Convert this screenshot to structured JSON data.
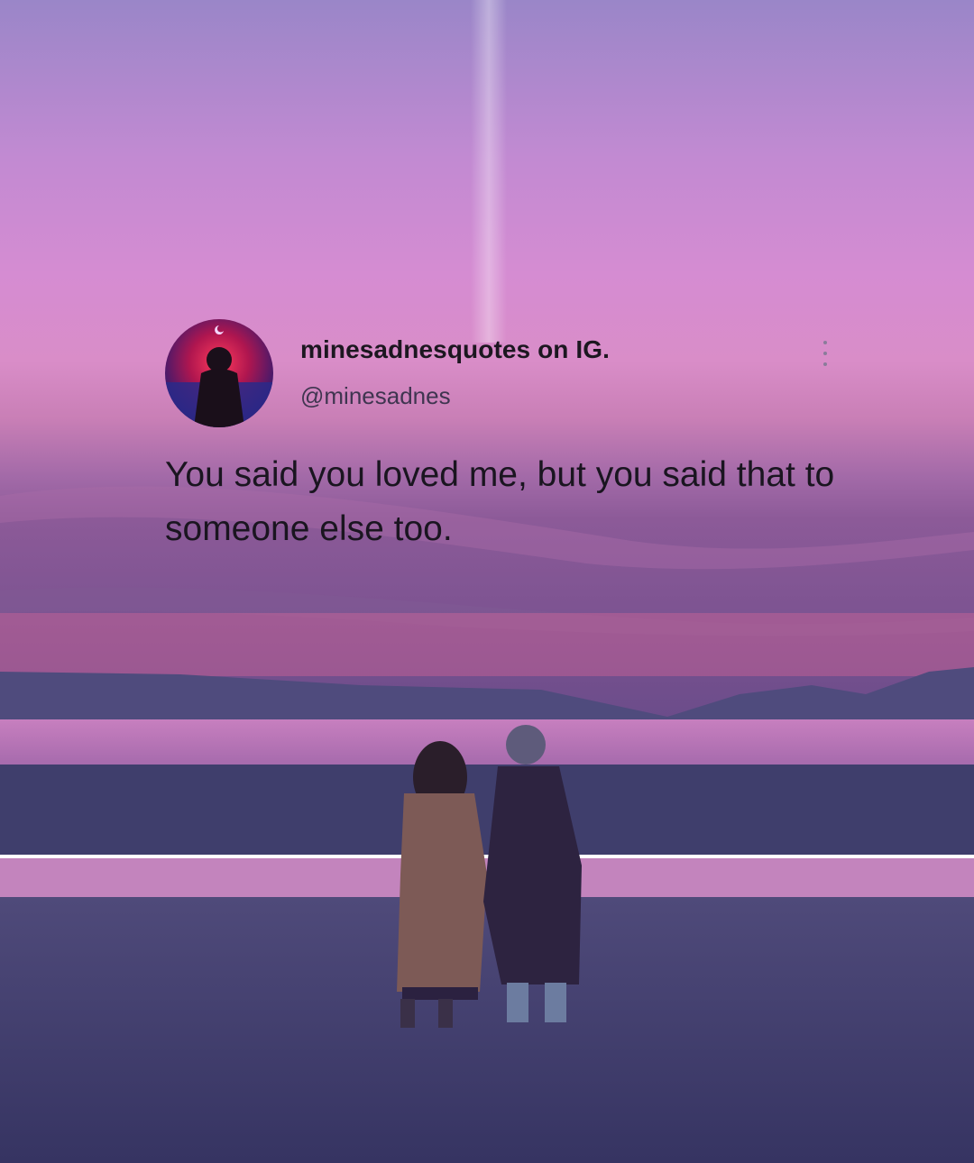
{
  "post": {
    "username": "minesadnesquotes on IG.",
    "handle": "@minesadnes",
    "quote": "You said you loved me, but you said that to someone else too."
  },
  "icons": {
    "more": "more-vertical-icon",
    "avatar": "profile-avatar"
  },
  "colors": {
    "sky_top": "#9b86c9",
    "sky_mid": "#d78ed3",
    "horizon": "#e87aa6",
    "sea": "#c67ab8",
    "sand": "#403e6c"
  }
}
